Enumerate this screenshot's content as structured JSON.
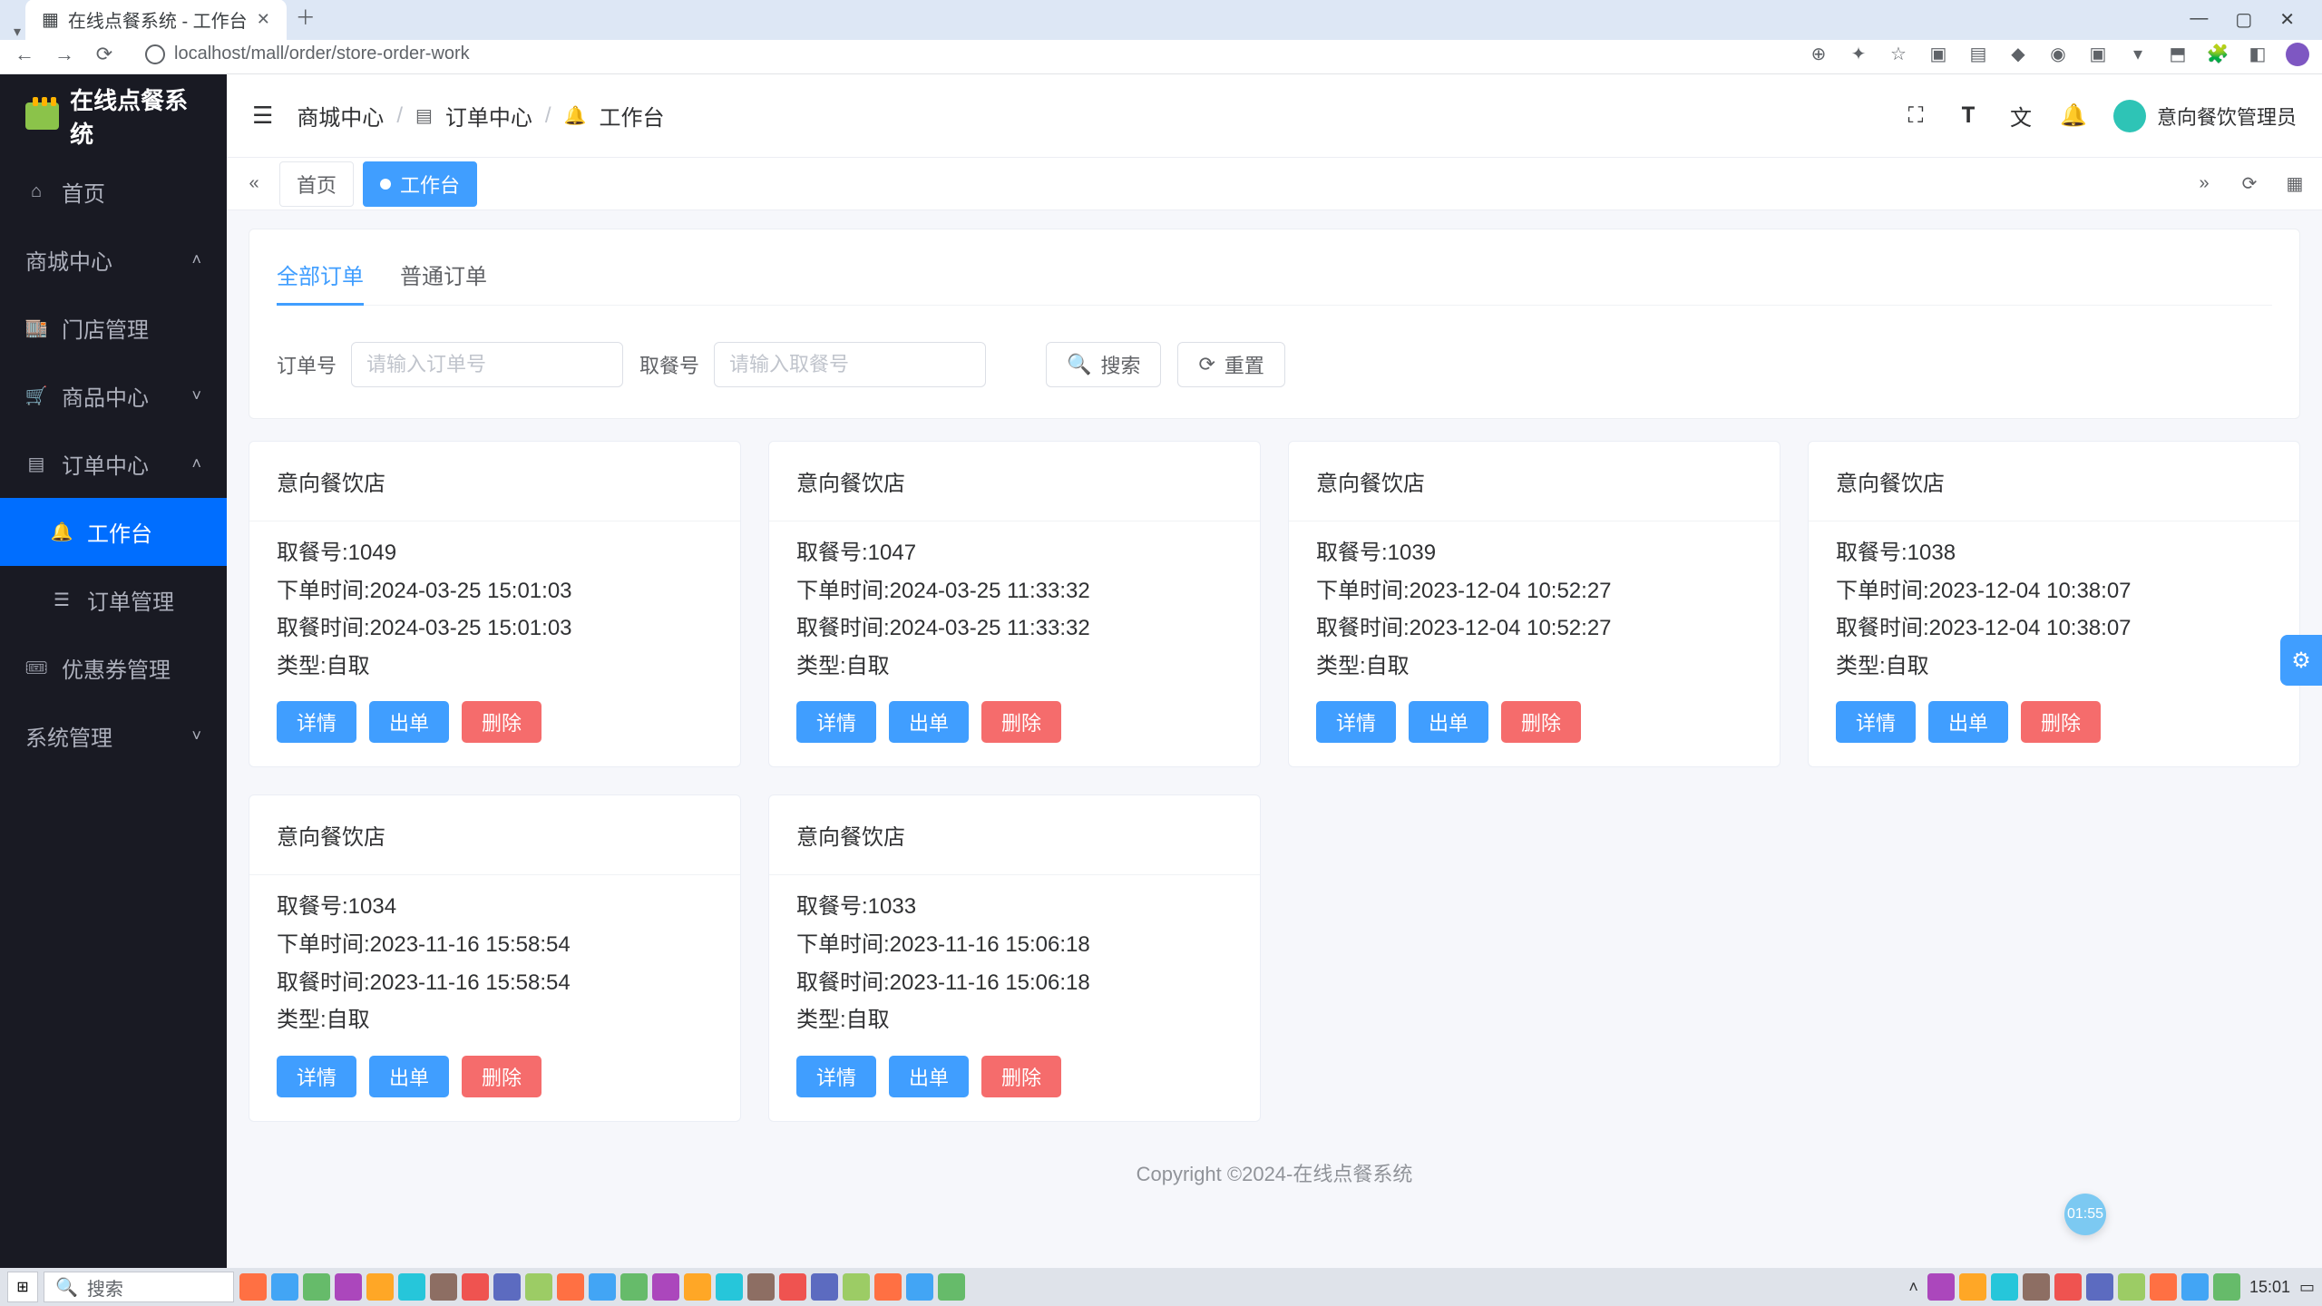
{
  "browser": {
    "tab_title": "在线点餐系统 - 工作台",
    "url": "localhost/mall/order/store-order-work"
  },
  "app": {
    "logo_text": "在线点餐系统",
    "user_name": "意向餐饮管理员"
  },
  "sidebar": {
    "home": "首页",
    "mall_center": "商城中心",
    "store_mgmt": "门店管理",
    "product_center": "商品中心",
    "order_center": "订单中心",
    "workbench": "工作台",
    "order_mgmt": "订单管理",
    "coupon_mgmt": "优惠券管理",
    "system_mgmt": "系统管理"
  },
  "breadcrumb": {
    "a": "商城中心",
    "b": "订单中心",
    "c": "工作台"
  },
  "tabrow": {
    "home": "首页",
    "work": "工作台"
  },
  "subtabs": {
    "all": "全部订单",
    "normal": "普通订单"
  },
  "filters": {
    "order_no_label": "订单号",
    "order_no_ph": "请输入订单号",
    "pickup_no_label": "取餐号",
    "pickup_no_ph": "请输入取餐号",
    "search": "搜索",
    "reset": "重置"
  },
  "labels": {
    "pickup_no": "取餐号:",
    "order_time": "下单时间:",
    "pickup_time": "取餐时间:",
    "type": "类型:",
    "btn_detail": "详情",
    "btn_out": "出单",
    "btn_del": "删除"
  },
  "orders": [
    {
      "store": "意向餐饮店",
      "pickup": "1049",
      "order_time": "2024-03-25 15:01:03",
      "pickup_time": "2024-03-25 15:01:03",
      "type": "自取"
    },
    {
      "store": "意向餐饮店",
      "pickup": "1047",
      "order_time": "2024-03-25 11:33:32",
      "pickup_time": "2024-03-25 11:33:32",
      "type": "自取"
    },
    {
      "store": "意向餐饮店",
      "pickup": "1039",
      "order_time": "2023-12-04 10:52:27",
      "pickup_time": "2023-12-04 10:52:27",
      "type": "自取"
    },
    {
      "store": "意向餐饮店",
      "pickup": "1038",
      "order_time": "2023-12-04 10:38:07",
      "pickup_time": "2023-12-04 10:38:07",
      "type": "自取"
    },
    {
      "store": "意向餐饮店",
      "pickup": "1034",
      "order_time": "2023-11-16 15:58:54",
      "pickup_time": "2023-11-16 15:58:54",
      "type": "自取"
    },
    {
      "store": "意向餐饮店",
      "pickup": "1033",
      "order_time": "2023-11-16 15:06:18",
      "pickup_time": "2023-11-16 15:06:18",
      "type": "自取"
    }
  ],
  "footer": {
    "copy": "Copyright ©2024-在线点餐系统"
  },
  "taskbar": {
    "search_ph": "搜索",
    "clock": "15:01"
  },
  "bubble": {
    "time": "01:55"
  }
}
